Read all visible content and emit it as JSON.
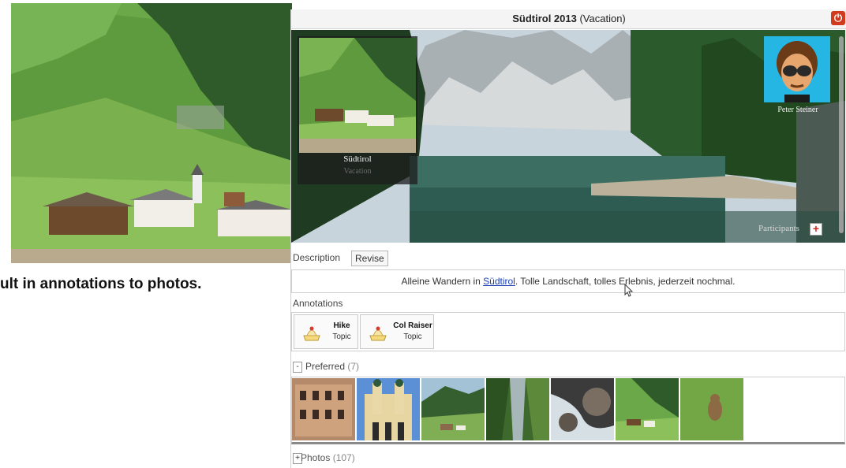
{
  "slide": {
    "caption": "ult in annotations to photos."
  },
  "window": {
    "title_bold": "Südtirol 2013",
    "title_suffix": " (Vacation)",
    "close_glyph": "⏻"
  },
  "hero": {
    "thumb_title": "Südtirol",
    "thumb_subtitle": "Vacation",
    "participant_name": "Peter Steiner",
    "participants_label": "Participants",
    "participants_add_glyph": "+"
  },
  "description": {
    "label": "Description",
    "revise_label": "Revise",
    "text_before": "Alleine Wandern in ",
    "link_text": "Südtirol",
    "text_after": ". Tolle Landschaft, tolles Erlebnis, jederzeit nochmal."
  },
  "annotations": {
    "label": "Annotations",
    "items": [
      {
        "name": "Hike",
        "kind": "Topic"
      },
      {
        "name": "Col Raiser",
        "kind": "Topic"
      }
    ]
  },
  "preferred": {
    "toggle": "-",
    "label": "Preferred",
    "count": "(7)"
  },
  "photos": {
    "toggle": "+",
    "label": "Photos",
    "count": "(107)"
  },
  "colors": {
    "close_red": "#d23a1e",
    "avatar_bg": "#26b6e4",
    "link_blue": "#1a3fb0"
  },
  "icons": [
    "power-icon",
    "plus-icon",
    "topic-icon",
    "cursor-icon"
  ]
}
